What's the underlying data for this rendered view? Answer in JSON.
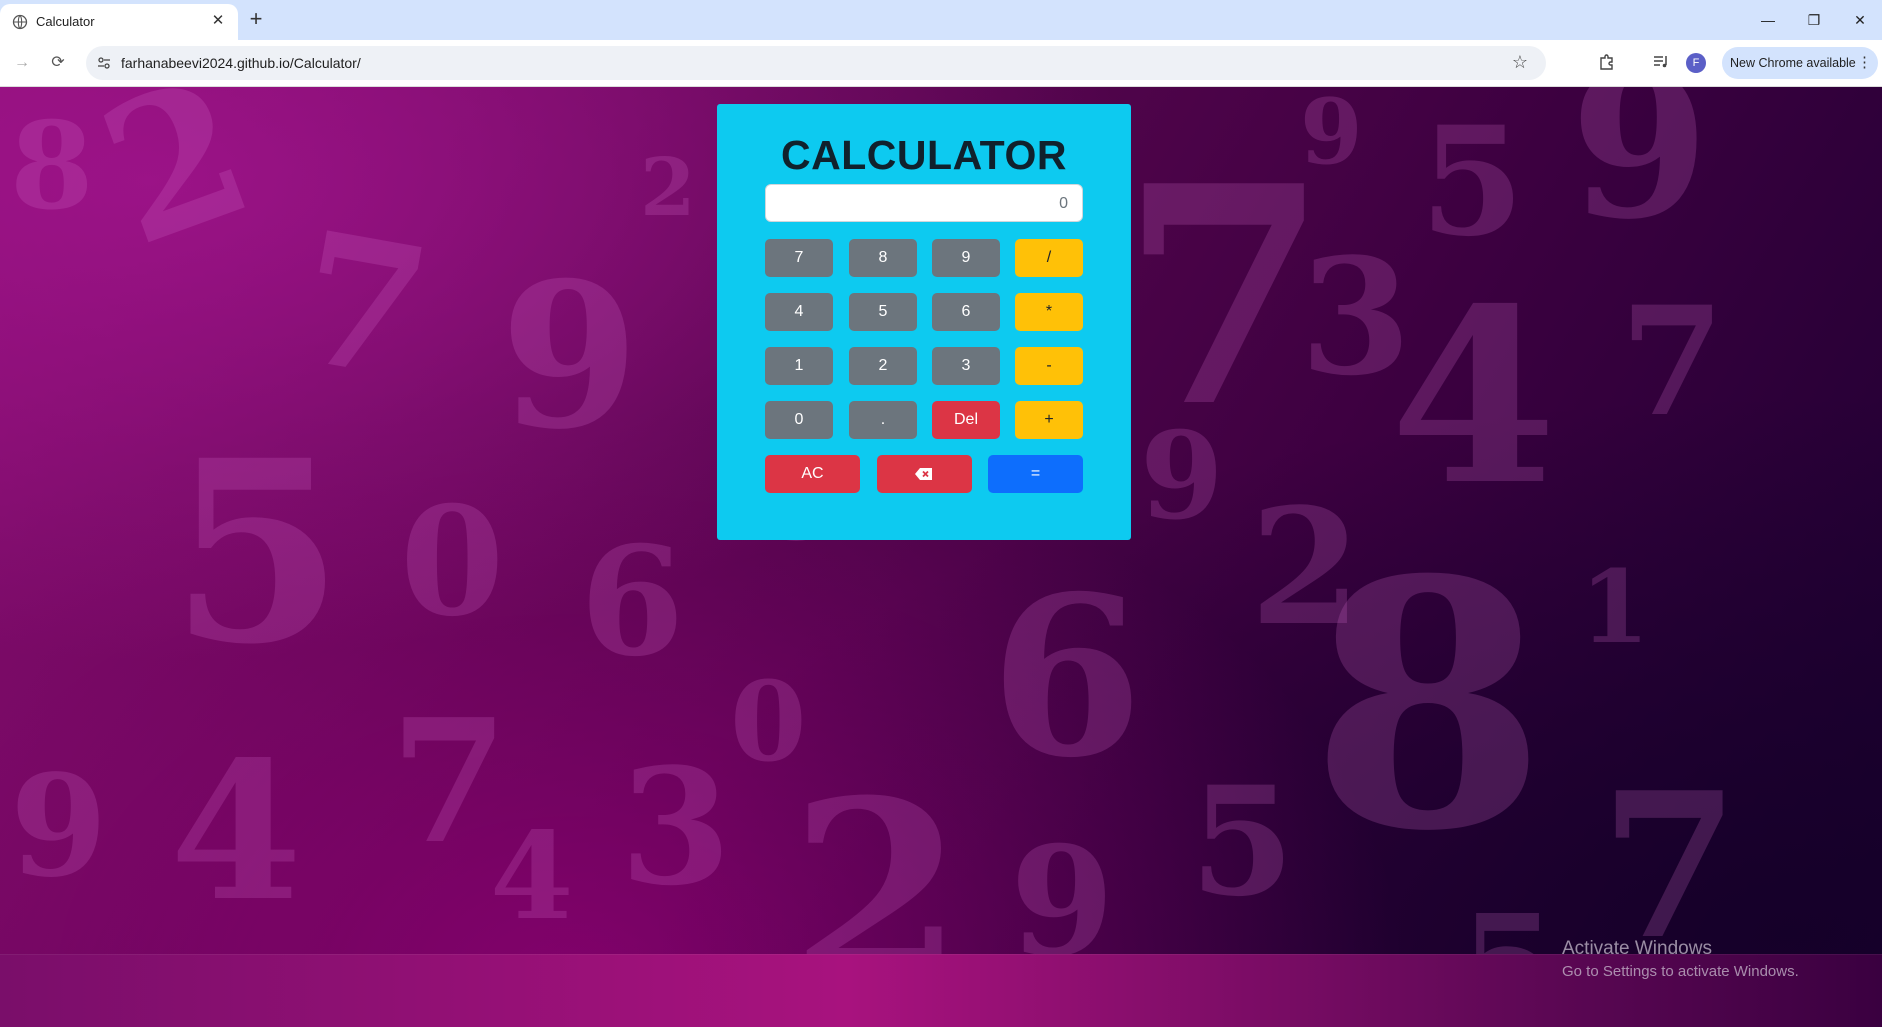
{
  "browser": {
    "tab_title": "Calculator",
    "tab_close": "✕",
    "new_tab": "+",
    "url": "farhanabeevi2024.github.io/Calculator/",
    "profile_initial": "F",
    "update_label": "New Chrome available",
    "window_controls": {
      "minimize": "—",
      "restore": "❐",
      "close": "✕"
    }
  },
  "calculator": {
    "title": "CALCULATOR",
    "display_value": "0",
    "keys": {
      "k7": "7",
      "k8": "8",
      "k9": "9",
      "divide": "/",
      "k4": "4",
      "k5": "5",
      "k6": "6",
      "multiply": "*",
      "k1": "1",
      "k2": "2",
      "k3": "3",
      "minus": "-",
      "k0": "0",
      "dot": ".",
      "del": "Del",
      "plus": "+",
      "ac": "AC",
      "equals": "="
    },
    "colors": {
      "panel": "#0dcaf0",
      "number_key": "#6c757d",
      "operator_key": "#ffc107",
      "danger_key": "#dc3545",
      "equals_key": "#0d6efd"
    }
  },
  "watermark": {
    "title": "Activate Windows",
    "subtitle": "Go to Settings to activate Windows."
  }
}
